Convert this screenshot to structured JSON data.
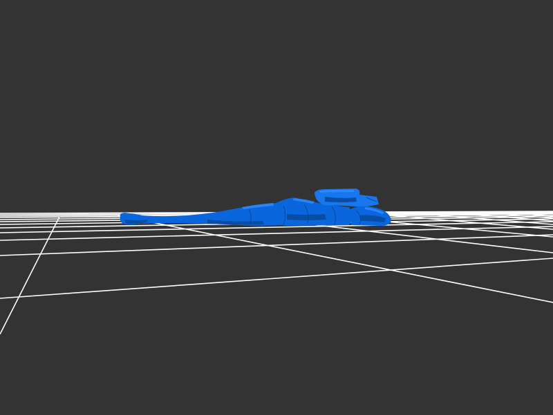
{
  "viewer": {
    "background_color": "#333333",
    "grid_color": "#ffffff",
    "model_color": "#0a66dd",
    "model_shadow_color": "#074a9e",
    "model_highlight_color": "#2e8cff",
    "model_description": "reclining-figure-3d-model"
  }
}
